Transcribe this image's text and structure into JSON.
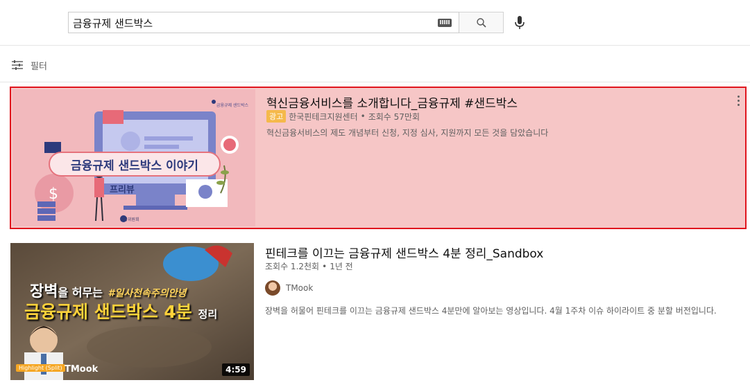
{
  "search": {
    "query": "금융규제 샌드박스",
    "keyboard_icon": "keyboard-icon",
    "search_icon": "search-icon",
    "mic_icon": "microphone-icon"
  },
  "filter": {
    "label": "필터",
    "icon": "filter-sliders-icon"
  },
  "results": [
    {
      "title": "혁신금융서비스를 소개합니다_금융규제 #샌드박스",
      "ad_badge": "광고",
      "channel": "한국핀테크지원센터",
      "separator": "•",
      "views": "조회수 57만회",
      "description": "혁신금융서비스의 제도 개념부터 신청, 지정 심사, 지원까지 모든 것을 담았습니다",
      "highlighted": true,
      "highlight_color": "#e0141d",
      "thumbnail": {
        "main_text": "금융규제 샌드박스 이야기",
        "sub_text": "프리뷰",
        "brand_text": "금융규제 샌드박스",
        "footer_text": "금융위원회",
        "background": "#f2b9bd"
      }
    },
    {
      "title": "핀테크를 이끄는 금융규제 샌드박스 4분 정리_Sandbox",
      "views": "조회수 1.2천회",
      "separator": "•",
      "age": "1년 전",
      "channel": "TMook",
      "description": "장벽을 허물어 핀테크를 이끄는 금융규제 샌드박스 4분만에 알아보는 영상입니다. 4월 1주차 이슈 하이라이트 중 분할 버전입니다.",
      "duration": "4:59",
      "thumbnail": {
        "line1_big": "장벽",
        "line1_mid": "을 허무는",
        "line1_tag": "#일사천속주의안녕",
        "line2_main": "금융규제 샌드박스 4분",
        "line2_tail": "정리",
        "badge": "Highlight (Split)",
        "logo": "TMook"
      }
    }
  ]
}
